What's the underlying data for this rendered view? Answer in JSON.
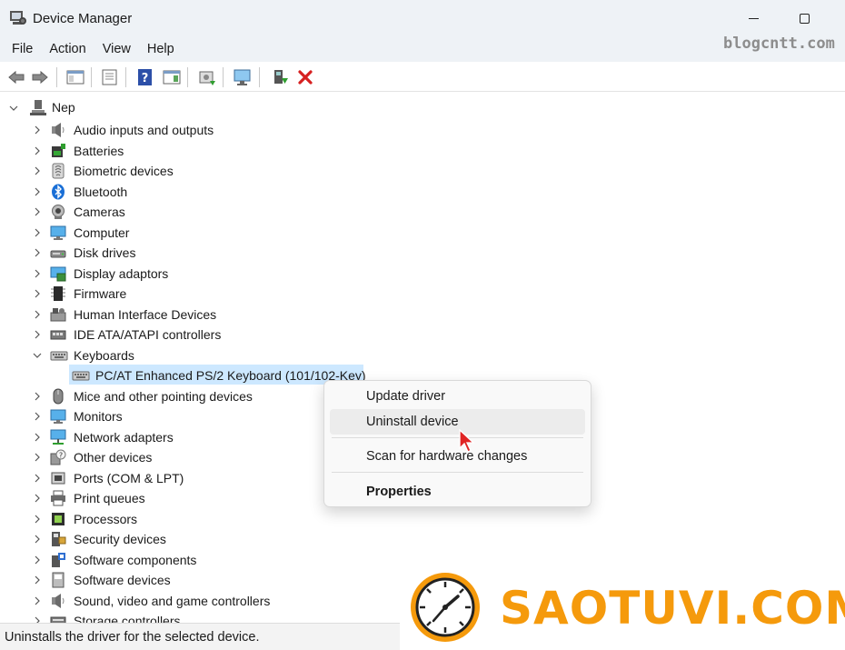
{
  "window": {
    "title": "Device Manager"
  },
  "watermark": "blogcntt.com",
  "menu": [
    "File",
    "Action",
    "View",
    "Help"
  ],
  "tree": {
    "root": "Nep",
    "categories": [
      {
        "label": "Audio inputs and outputs",
        "icon": "speaker-icon",
        "expanded": false
      },
      {
        "label": "Batteries",
        "icon": "battery-icon",
        "expanded": false
      },
      {
        "label": "Biometric devices",
        "icon": "fingerprint-icon",
        "expanded": false
      },
      {
        "label": "Bluetooth",
        "icon": "bluetooth-icon",
        "expanded": false
      },
      {
        "label": "Cameras",
        "icon": "camera-icon",
        "expanded": false
      },
      {
        "label": "Computer",
        "icon": "computer-icon",
        "expanded": false
      },
      {
        "label": "Disk drives",
        "icon": "disk-icon",
        "expanded": false
      },
      {
        "label": "Display adaptors",
        "icon": "display-adapter-icon",
        "expanded": false
      },
      {
        "label": "Firmware",
        "icon": "chip-icon",
        "expanded": false
      },
      {
        "label": "Human Interface Devices",
        "icon": "hid-icon",
        "expanded": false
      },
      {
        "label": "IDE ATA/ATAPI controllers",
        "icon": "ide-icon",
        "expanded": false
      },
      {
        "label": "Keyboards",
        "icon": "keyboard-icon",
        "expanded": true
      },
      {
        "label": "PC/AT Enhanced PS/2 Keyboard (101/102-Key)",
        "icon": "keyboard-icon",
        "child": true,
        "selected": true
      },
      {
        "label": "Mice and other pointing devices",
        "icon": "mouse-icon",
        "expanded": false
      },
      {
        "label": "Monitors",
        "icon": "monitor-icon",
        "expanded": false
      },
      {
        "label": "Network adapters",
        "icon": "network-icon",
        "expanded": false
      },
      {
        "label": "Other devices",
        "icon": "unknown-device-icon",
        "expanded": false
      },
      {
        "label": "Ports (COM & LPT)",
        "icon": "port-icon",
        "expanded": false
      },
      {
        "label": "Print queues",
        "icon": "printer-icon",
        "expanded": false
      },
      {
        "label": "Processors",
        "icon": "processor-icon",
        "expanded": false
      },
      {
        "label": "Security devices",
        "icon": "security-icon",
        "expanded": false
      },
      {
        "label": "Software components",
        "icon": "software-component-icon",
        "expanded": false
      },
      {
        "label": "Software devices",
        "icon": "software-device-icon",
        "expanded": false
      },
      {
        "label": "Sound, video and game controllers",
        "icon": "speaker-icon",
        "expanded": false
      },
      {
        "label": "Storage controllers",
        "icon": "storage-icon",
        "expanded": false
      }
    ]
  },
  "context_menu": {
    "update": "Update driver",
    "uninstall": "Uninstall device",
    "scan": "Scan for hardware changes",
    "properties": "Properties"
  },
  "status": "Uninstalls the driver for the selected device.",
  "logo": "SAOTUVI.COM",
  "colors": {
    "selection": "#cde8ff",
    "logo_orange": "#f59a0c",
    "titlebar": "#eef2f6"
  }
}
